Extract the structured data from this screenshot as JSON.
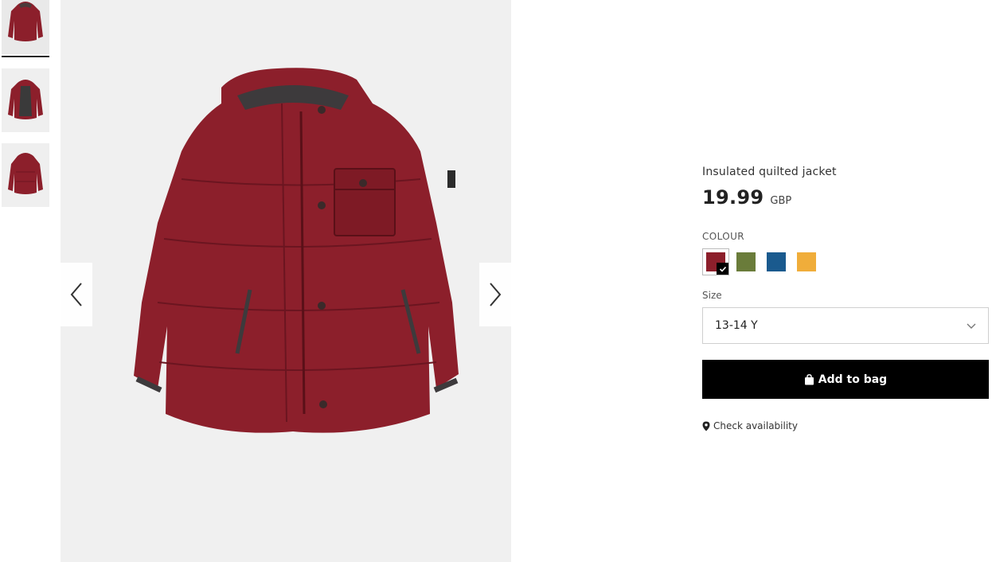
{
  "product": {
    "name": "Insulated quilted jacket",
    "price": "19.99",
    "currency": "GBP"
  },
  "colour": {
    "label": "COLOUR",
    "swatches": [
      {
        "name": "burgundy",
        "hex": "#8c1f2b",
        "selected": true
      },
      {
        "name": "khaki",
        "hex": "#6a7c3a",
        "selected": false
      },
      {
        "name": "blue",
        "hex": "#1a5a8e",
        "selected": false
      },
      {
        "name": "mustard",
        "hex": "#f0ad3a",
        "selected": false
      }
    ]
  },
  "size": {
    "label": "Size",
    "selected": "13-14 Y"
  },
  "actions": {
    "add_to_bag": "Add to bag",
    "check_availability": "Check availability"
  },
  "gallery": {
    "thumbnails": [
      "front-view",
      "open-view",
      "back-view"
    ],
    "active_index": 0
  },
  "icons": {
    "prev": "chevron-left-icon",
    "next": "chevron-right-icon",
    "dropdown": "chevron-down-icon",
    "bag": "shopping-bag-icon",
    "location": "map-pin-icon",
    "check": "checkmark-icon"
  },
  "colors": {
    "accent": "#000000",
    "jacket": "#8c1f2b"
  }
}
